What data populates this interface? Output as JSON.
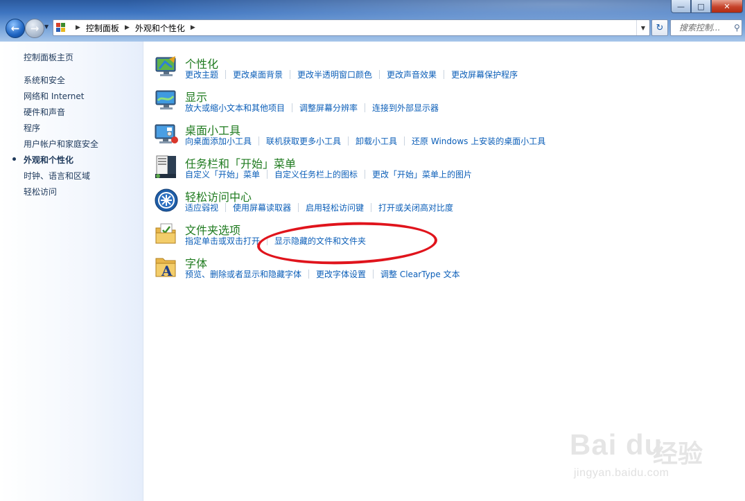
{
  "window": {
    "min_glyph": "—",
    "max_glyph": "□",
    "close_glyph": "✕"
  },
  "address": {
    "crumbs": [
      "控制面板",
      "外观和个性化"
    ]
  },
  "search": {
    "placeholder": "搜索控制..."
  },
  "sidebar": {
    "home": "控制面板主页",
    "items": [
      {
        "label": "系统和安全",
        "current": false
      },
      {
        "label": "网络和 Internet",
        "current": false
      },
      {
        "label": "硬件和声音",
        "current": false
      },
      {
        "label": "程序",
        "current": false
      },
      {
        "label": "用户帐户和家庭安全",
        "current": false
      },
      {
        "label": "外观和个性化",
        "current": true
      },
      {
        "label": "时钟、语言和区域",
        "current": false
      },
      {
        "label": "轻松访问",
        "current": false
      }
    ]
  },
  "categories": [
    {
      "title": "个性化",
      "icon": "personalization-icon",
      "links": [
        "更改主题",
        "更改桌面背景",
        "更改半透明窗口颜色",
        "更改声音效果",
        "更改屏幕保护程序"
      ]
    },
    {
      "title": "显示",
      "icon": "display-icon",
      "links": [
        "放大或缩小文本和其他项目",
        "调整屏幕分辨率",
        "连接到外部显示器"
      ]
    },
    {
      "title": "桌面小工具",
      "icon": "gadgets-icon",
      "links": [
        "向桌面添加小工具",
        "联机获取更多小工具",
        "卸载小工具",
        "还原 Windows 上安装的桌面小工具"
      ]
    },
    {
      "title": "任务栏和「开始」菜单",
      "icon": "taskbar-icon",
      "links": [
        "自定义「开始」菜单",
        "自定义任务栏上的图标",
        "更改「开始」菜单上的图片"
      ]
    },
    {
      "title": "轻松访问中心",
      "icon": "ease-of-access-icon",
      "links": [
        "适应弱视",
        "使用屏幕读取器",
        "启用轻松访问键",
        "打开或关闭高对比度"
      ]
    },
    {
      "title": "文件夹选项",
      "icon": "folder-options-icon",
      "links": [
        "指定单击或双击打开",
        "显示隐藏的文件和文件夹"
      ]
    },
    {
      "title": "字体",
      "icon": "fonts-icon",
      "links": [
        "预览、删除或者显示和隐藏字体",
        "更改字体设置",
        "调整 ClearType 文本"
      ]
    }
  ],
  "watermark": {
    "logo": "Bai du",
    "cn": "经验",
    "url": "jingyan.baidu.com"
  },
  "colors": {
    "category_title": "#1e7a1e",
    "link": "#0b5eb8",
    "annotation": "#e0141c"
  }
}
